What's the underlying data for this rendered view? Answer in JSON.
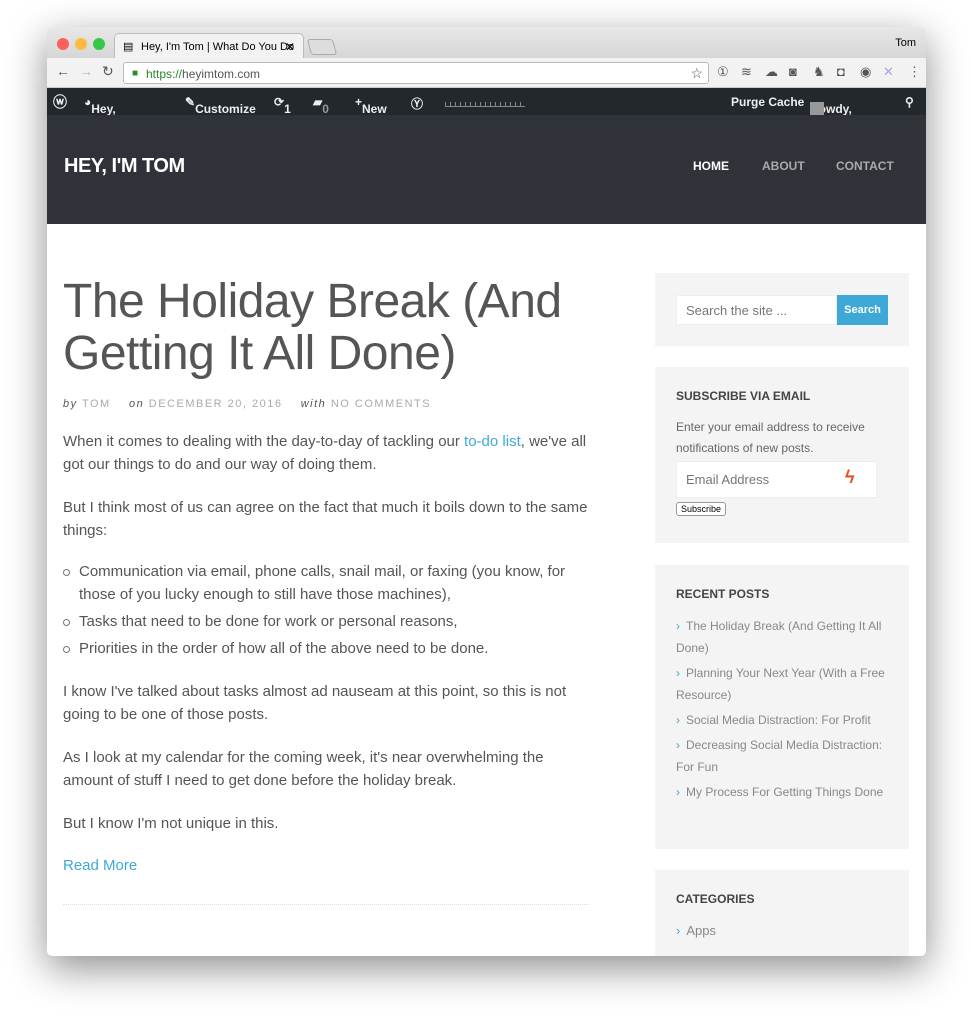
{
  "browser": {
    "tab_title": "Hey, I'm Tom | What Do You Do",
    "user": "Tom",
    "url_scheme": "https://",
    "url_host": "heyimtom.com"
  },
  "adminbar": {
    "site": "Hey, I'm Tom",
    "customize": "Customize",
    "updates": "1",
    "comments": "0",
    "new": "New",
    "purge": "Purge Cache",
    "howdy": "Howdy, Tom"
  },
  "site": {
    "logo": "HEY, I'M TOM",
    "nav": [
      "HOME",
      "ABOUT",
      "CONTACT"
    ]
  },
  "post": {
    "title": "The Holiday Break (And Getting It All Done)",
    "by": "by",
    "author": "TOM",
    "on": "on",
    "date": "DECEMBER 20, 2016",
    "with": "with",
    "comments": "NO COMMENTS",
    "p1_a": "When it comes to dealing with the day-to-day of tackling our ",
    "p1_link": "to-do list",
    "p1_b": ", we've all got our things to do and our way of doing them.",
    "p2": "But I think most of us can agree on the fact that much it boils down to the same things:",
    "list": [
      "Communication via email, phone calls, snail mail, or faxing (you know, for those of you lucky enough to still have those machines),",
      "Tasks that need to be done for work or personal reasons,",
      "Priorities in the order of how all of the above need to be done."
    ],
    "p3": "I know I've talked about tasks almost ad nauseam at this point, so this is not going to be one of those posts.",
    "p4": "As I look at my calendar for the coming week, it's near overwhelming the amount of stuff I need to get done before the holiday break.",
    "p5": "But I know I'm not unique in this.",
    "read_more": "Read More"
  },
  "sidebar": {
    "search_placeholder": "Search the site ...",
    "search_button": "Search",
    "subscribe_title": "SUBSCRIBE VIA EMAIL",
    "subscribe_text": "Enter your email address to receive notifications of new posts.",
    "email_placeholder": "Email Address",
    "subscribe_button": "Subscribe",
    "recent_title": "RECENT POSTS",
    "recent": [
      "The Holiday Break (And Getting It All Done)",
      "Planning Your Next Year (With a Free Resource)",
      "Social Media Distraction: For Profit",
      "Decreasing Social Media Distraction: For Fun",
      "My Process For Getting Things Done"
    ],
    "categories_title": "CATEGORIES",
    "categories": [
      "Apps"
    ]
  }
}
